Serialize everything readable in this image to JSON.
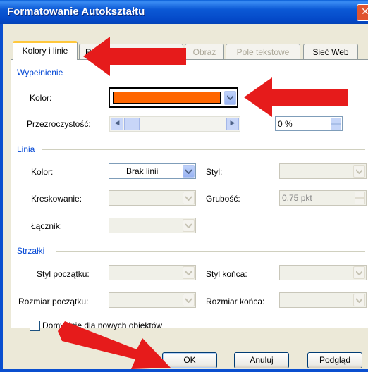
{
  "window": {
    "title": "Formatowanie Autokształtu",
    "close_glyph": "✕"
  },
  "tabs": [
    {
      "label": "Kolory i linie",
      "active": true
    },
    {
      "label": "R",
      "active": false
    },
    {
      "label": "Obraz",
      "disabled": true
    },
    {
      "label": "Pole tekstowe",
      "disabled": true
    },
    {
      "label": "Sieć Web",
      "active": false
    }
  ],
  "fill": {
    "section": "Wypełnienie",
    "color_label": "Kolor:",
    "color_value": "#ff6600",
    "transparency_label": "Przezroczystość:",
    "transparency_value": "0 %"
  },
  "line": {
    "section": "Linia",
    "color_label": "Kolor:",
    "color_value": "Brak linii",
    "style_label": "Styl:",
    "dash_label": "Kreskowanie:",
    "weight_label": "Grubość:",
    "weight_value": "0,75 pkt",
    "connector_label": "Łącznik:"
  },
  "arrows": {
    "section": "Strzałki",
    "begin_style_label": "Styl początku:",
    "end_style_label": "Styl końca:",
    "begin_size_label": "Rozmiar początku:",
    "end_size_label": "Rozmiar końca:"
  },
  "default_checkbox": {
    "label": "Domyślnie dla nowych obiektów",
    "checked": false
  },
  "buttons": {
    "ok": "OK",
    "cancel": "Anuluj",
    "preview": "Podgląd"
  },
  "annotations": {
    "arrow_color": "#e61b1b"
  }
}
